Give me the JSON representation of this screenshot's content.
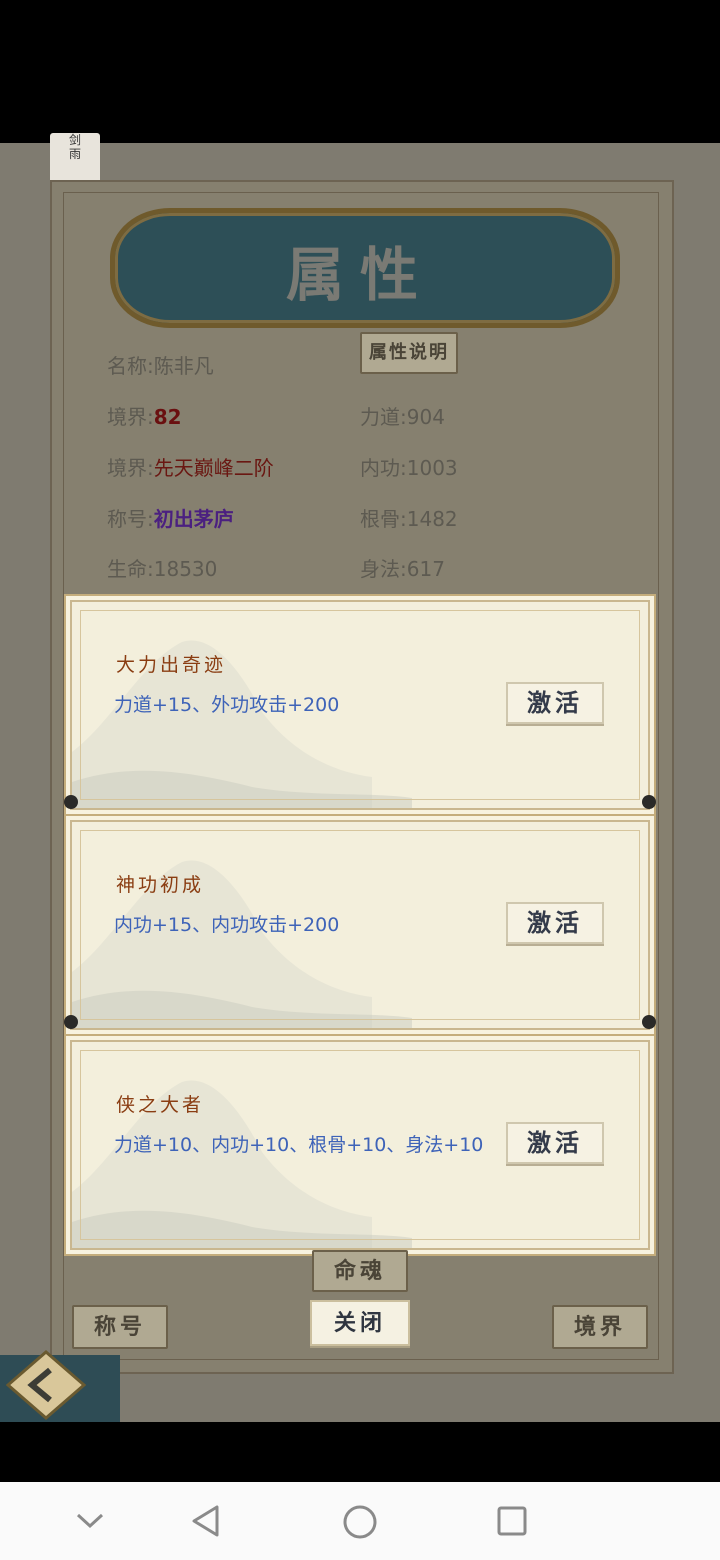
{
  "app_icon": {
    "chars": [
      "剑",
      "雨",
      "风",
      "云"
    ]
  },
  "panel": {
    "title": "属性",
    "explain_button": "属性说明",
    "rows": [
      {
        "label": "名称:",
        "value": "陈非凡"
      },
      {
        "label": "境界:",
        "value": "82"
      },
      {
        "label": "力道:",
        "value": "904"
      },
      {
        "label": "境界:",
        "value": "先天巅峰二阶"
      },
      {
        "label": "内功:",
        "value": "1003"
      },
      {
        "label": "称号:",
        "value": "初出茅庐"
      },
      {
        "label": "根骨:",
        "value": "1482"
      },
      {
        "label": "生命:",
        "value": "18530"
      },
      {
        "label": "身法:",
        "value": "617"
      }
    ]
  },
  "dialogs": [
    {
      "title": "大力出奇迹",
      "desc": "力道+15、外功攻击+200",
      "button": "激活"
    },
    {
      "title": "神功初成",
      "desc": "内功+15、内功攻击+200",
      "button": "激活"
    },
    {
      "title": "侠之大者",
      "desc": "力道+10、内功+10、根骨+10、身法+10",
      "button": "激活"
    }
  ],
  "bottom": {
    "tab_left": "称号",
    "tab_center": "命魂",
    "tab_right": "境界",
    "close": "关闭"
  },
  "colors": {
    "dialog_title": "#8a3d12",
    "dialog_desc": "#3e63b8",
    "banner": "#2d4f57"
  },
  "nav_icons": [
    "chevron-down-icon",
    "back-triangle-icon",
    "home-circle-icon",
    "recents-square-icon"
  ]
}
